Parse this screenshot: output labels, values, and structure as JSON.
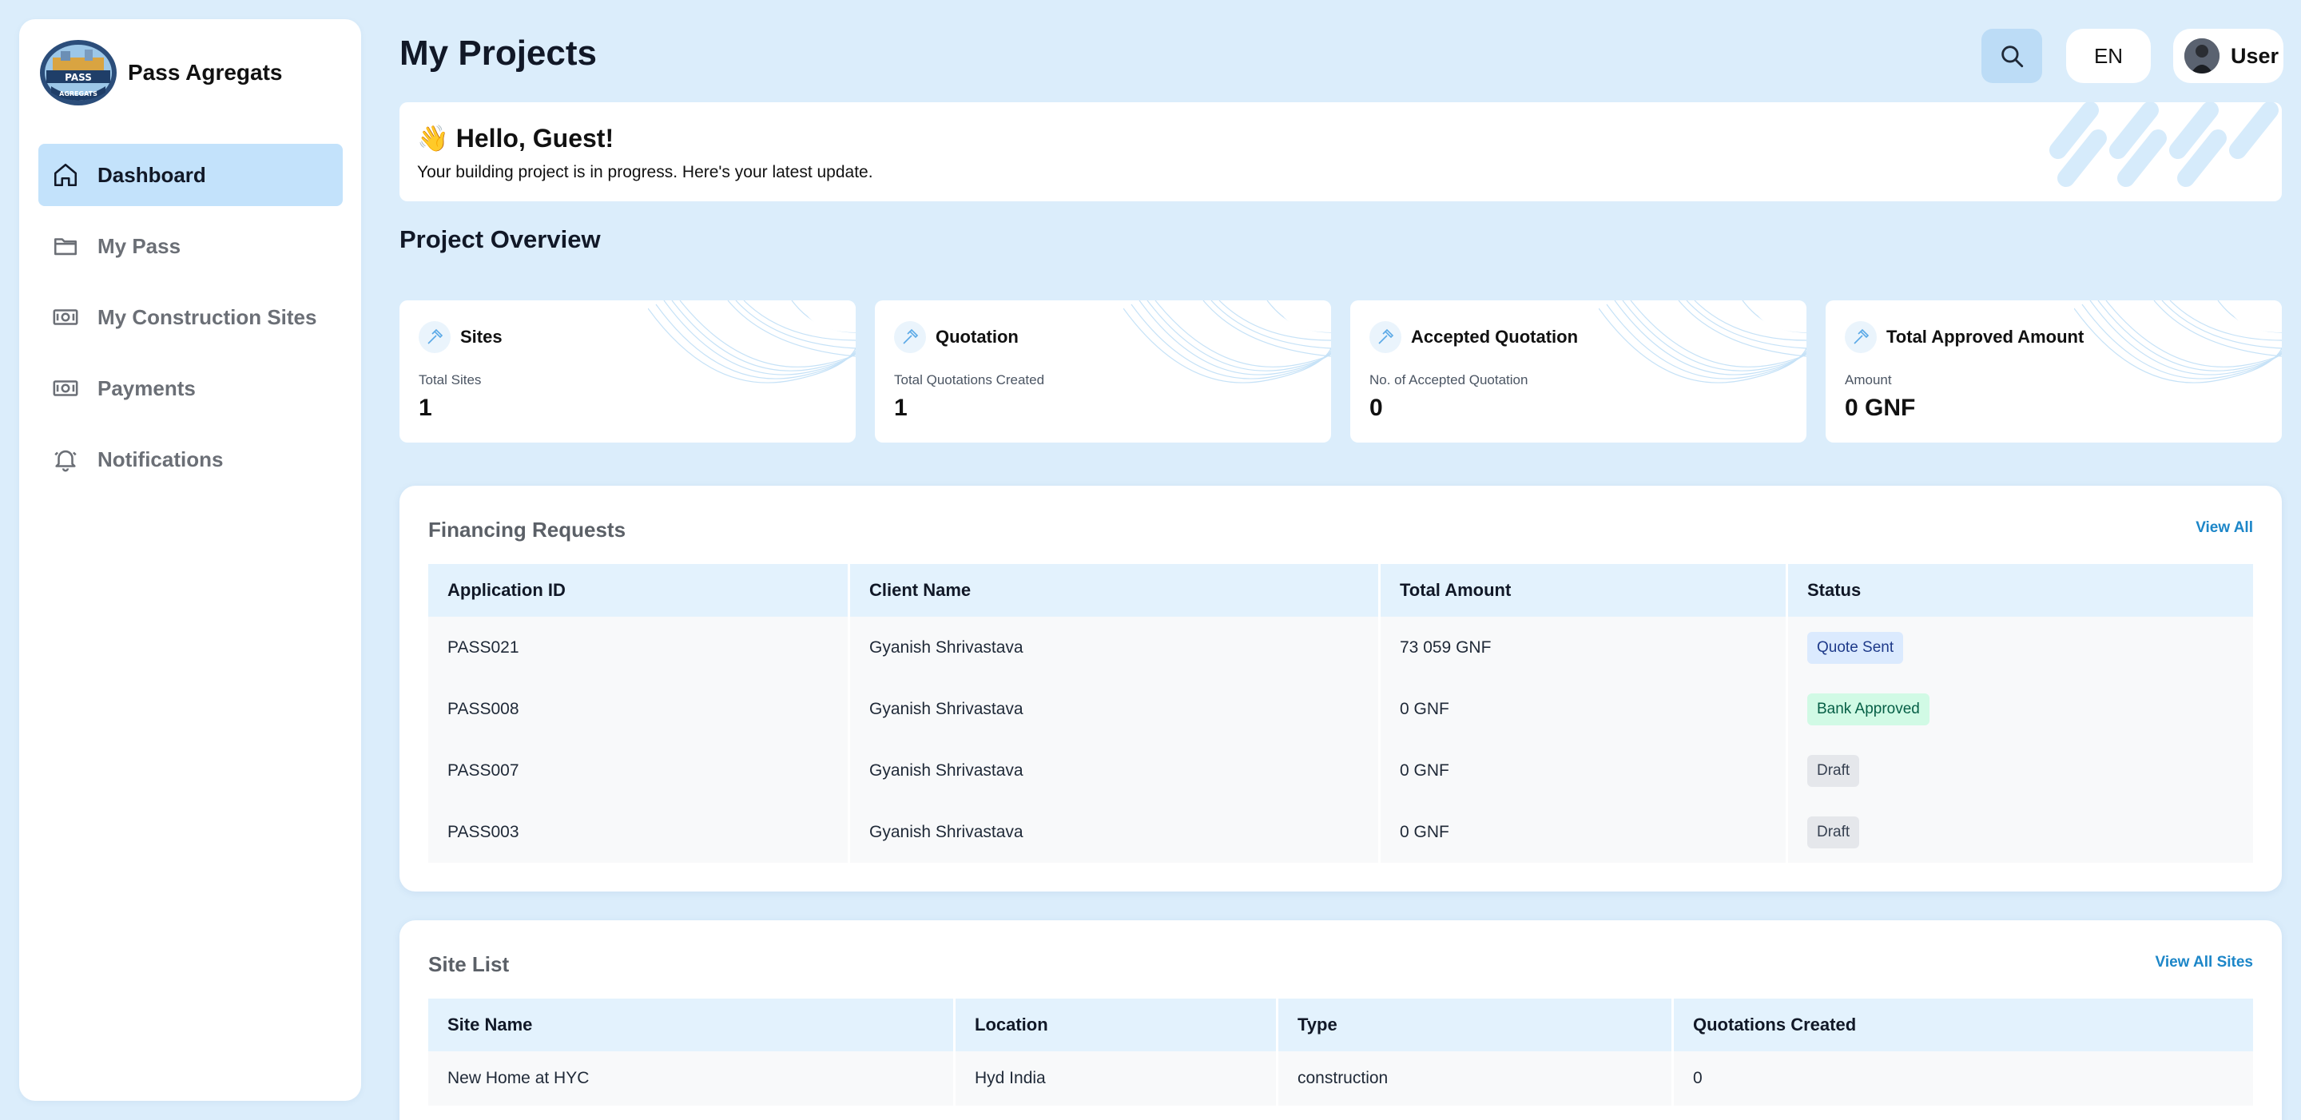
{
  "brand": {
    "name": "Pass Agregats",
    "logo_text_top": "PASS",
    "logo_text_bottom": "AGREGATS"
  },
  "sidebar": {
    "items": [
      {
        "label": "Dashboard",
        "icon": "home-icon",
        "active": true
      },
      {
        "label": "My Pass",
        "icon": "folder-icon",
        "active": false
      },
      {
        "label": "My Construction Sites",
        "icon": "banknote-icon",
        "active": false
      },
      {
        "label": "Payments",
        "icon": "banknote-icon",
        "active": false
      },
      {
        "label": "Notifications",
        "icon": "bell-icon",
        "active": false
      }
    ]
  },
  "header": {
    "title": "My Projects",
    "language": "EN",
    "user_label": "User"
  },
  "welcome": {
    "greeting": "👋 Hello, Guest!",
    "message": "Your building project is in progress. Here's your latest update."
  },
  "overview": {
    "title": "Project Overview",
    "cards": [
      {
        "title": "Sites",
        "label": "Total Sites",
        "value": "1"
      },
      {
        "title": "Quotation",
        "label": "Total Quotations Created",
        "value": "1"
      },
      {
        "title": "Accepted Quotation",
        "label": "No. of Accepted Quotation",
        "value": "0"
      },
      {
        "title": "Total Approved Amount",
        "label": "Amount",
        "value": "0 GNF"
      }
    ]
  },
  "financing": {
    "title": "Financing Requests",
    "view_all": "View All",
    "columns": [
      "Application ID",
      "Client Name",
      "Total Amount",
      "Status"
    ],
    "rows": [
      {
        "id": "PASS021",
        "client": "Gyanish Shrivastava",
        "amount": "73 059 GNF",
        "status": "Quote Sent",
        "status_type": "quote"
      },
      {
        "id": "PASS008",
        "client": "Gyanish Shrivastava",
        "amount": "0 GNF",
        "status": "Bank Approved",
        "status_type": "bank"
      },
      {
        "id": "PASS007",
        "client": "Gyanish Shrivastava",
        "amount": "0 GNF",
        "status": "Draft",
        "status_type": "draft"
      },
      {
        "id": "PASS003",
        "client": "Gyanish Shrivastava",
        "amount": "0 GNF",
        "status": "Draft",
        "status_type": "draft"
      }
    ]
  },
  "sites": {
    "title": "Site List",
    "view_all": "View All Sites",
    "columns": [
      "Site Name",
      "Location",
      "Type",
      "Quotations Created"
    ],
    "rows": [
      {
        "name": "New Home at HYC",
        "location": "Hyd India",
        "type": "construction",
        "quotations": "0"
      }
    ]
  },
  "colors": {
    "background": "#dbedfb",
    "active_nav": "#c3e2fb",
    "accent_link": "#1c86c8",
    "table_header": "#e3f2fd"
  }
}
